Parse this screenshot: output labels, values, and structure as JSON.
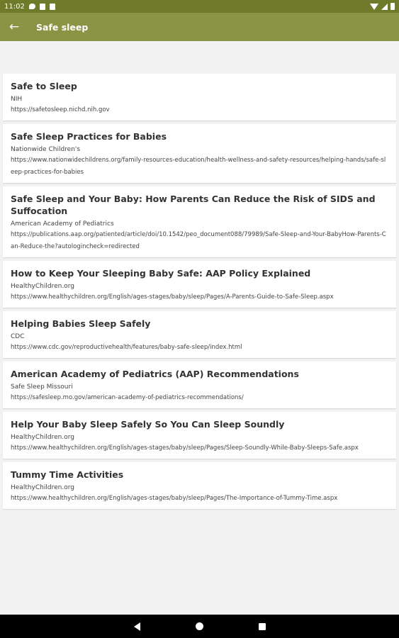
{
  "status_bar": {
    "time": "11:02"
  },
  "app_bar": {
    "back_glyph": "←",
    "title": "Safe sleep"
  },
  "resources": [
    {
      "title": "Safe to Sleep",
      "source": "NIH",
      "url": "https://safetosleep.nichd.nih.gov"
    },
    {
      "title": "Safe Sleep Practices for Babies",
      "source": "Nationwide Children's",
      "url": "https://www.nationwidechildrens.org/family-resources-education/health-wellness-and-safety-resources/helping-hands/safe-sleep-practices-for-babies"
    },
    {
      "title": "Safe Sleep and Your Baby: How Parents Can Reduce the Risk of SIDS and Suffocation",
      "source": "American Academy of Pediatrics",
      "url": "https://publications.aap.org/patiented/article/doi/10.1542/peo_document088/79989/Safe-Sleep-and-Your-BabyHow-Parents-Can-Reduce-the?autologincheck=redirected"
    },
    {
      "title": "How to Keep Your Sleeping Baby Safe: AAP Policy Explained",
      "source": "HealthyChildren.org",
      "url": "https://www.healthychildren.org/English/ages-stages/baby/sleep/Pages/A-Parents-Guide-to-Safe-Sleep.aspx"
    },
    {
      "title": "Helping Babies Sleep Safely",
      "source": "CDC",
      "url": "https://www.cdc.gov/reproductivehealth/features/baby-safe-sleep/index.html"
    },
    {
      "title": "American Academy of Pediatrics (AAP) Recommendations",
      "source": "Safe Sleep Missouri",
      "url": "https://safesleep.mo.gov/american-academy-of-pediatrics-recommendations/"
    },
    {
      "title": "Help Your Baby Sleep Safely So You Can Sleep Soundly",
      "source": "HealthyChildren.org",
      "url": "https://www.healthychildren.org/English/ages-stages/baby/sleep/Pages/Sleep-Soundly-While-Baby-Sleeps-Safe.aspx"
    },
    {
      "title": "Tummy Time Activities",
      "source": "HealthyChildren.org",
      "url": "https://www.healthychildren.org/English/ages-stages/baby/sleep/Pages/The-Importance-of-Tummy-Time.aspx"
    }
  ],
  "colors": {
    "status_bar": "#6f7a2b",
    "app_bar": "#8b9444",
    "background": "#f2f2f2",
    "nav_bar": "#000000"
  },
  "icons": [
    "message-icon",
    "sim-icon",
    "storage-icon",
    "wifi-icon",
    "signal-icon",
    "battery-icon",
    "back-arrow-icon",
    "nav-back-icon",
    "nav-home-icon",
    "nav-recents-icon"
  ]
}
